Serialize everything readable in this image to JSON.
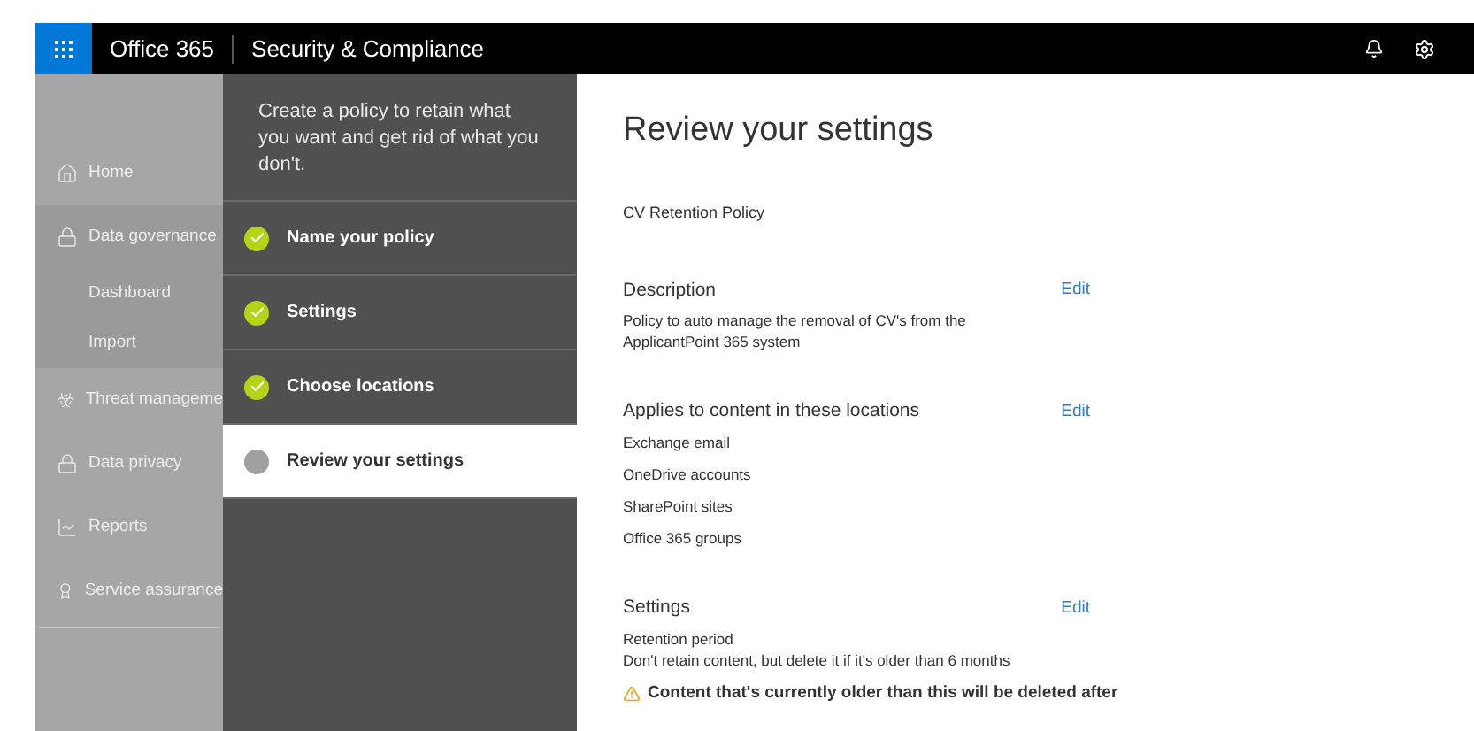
{
  "header": {
    "app_name": "Office 365",
    "title": "Security & Compliance"
  },
  "sidebar": {
    "items": [
      {
        "kind": "home",
        "label": "Home",
        "selected": false
      },
      {
        "kind": "lock",
        "label": "Data governance",
        "selected": true,
        "children": [
          {
            "label": "Dashboard"
          },
          {
            "label": "Import"
          }
        ]
      },
      {
        "kind": "biohazard",
        "label": "Threat manageme",
        "selected": false
      },
      {
        "kind": "lock",
        "label": "Data privacy",
        "selected": false
      },
      {
        "kind": "chart",
        "label": "Reports",
        "selected": false
      },
      {
        "kind": "badge",
        "label": "Service assurance",
        "selected": false
      }
    ]
  },
  "wizard": {
    "intro": "Create a policy to retain what you want and get rid of what you don't.",
    "steps": [
      {
        "label": "Name your policy",
        "done": true,
        "selected": false
      },
      {
        "label": "Settings",
        "done": true,
        "selected": false
      },
      {
        "label": "Choose locations",
        "done": true,
        "selected": false
      },
      {
        "label": "Review your settings",
        "done": false,
        "selected": true
      }
    ]
  },
  "content": {
    "title": "Review your settings",
    "policy_name": "CV Retention Policy",
    "sections": [
      {
        "kind": "text",
        "heading": "Description",
        "edit": "Edit",
        "lines": [
          "Policy to auto manage the removal of CV's from the ApplicantPoint 365 system"
        ]
      },
      {
        "kind": "list",
        "heading": "Applies to content in these locations",
        "edit": "Edit",
        "lines": [
          "Exchange email",
          "OneDrive accounts",
          "SharePoint sites",
          "Office 365 groups"
        ]
      },
      {
        "kind": "text",
        "heading": "Settings",
        "edit": "Edit",
        "lines": [
          "Retention period",
          "Don't retain content, but delete it if it's older than 6 months"
        ]
      }
    ],
    "warning": "Content that's currently older than this will be deleted after"
  }
}
